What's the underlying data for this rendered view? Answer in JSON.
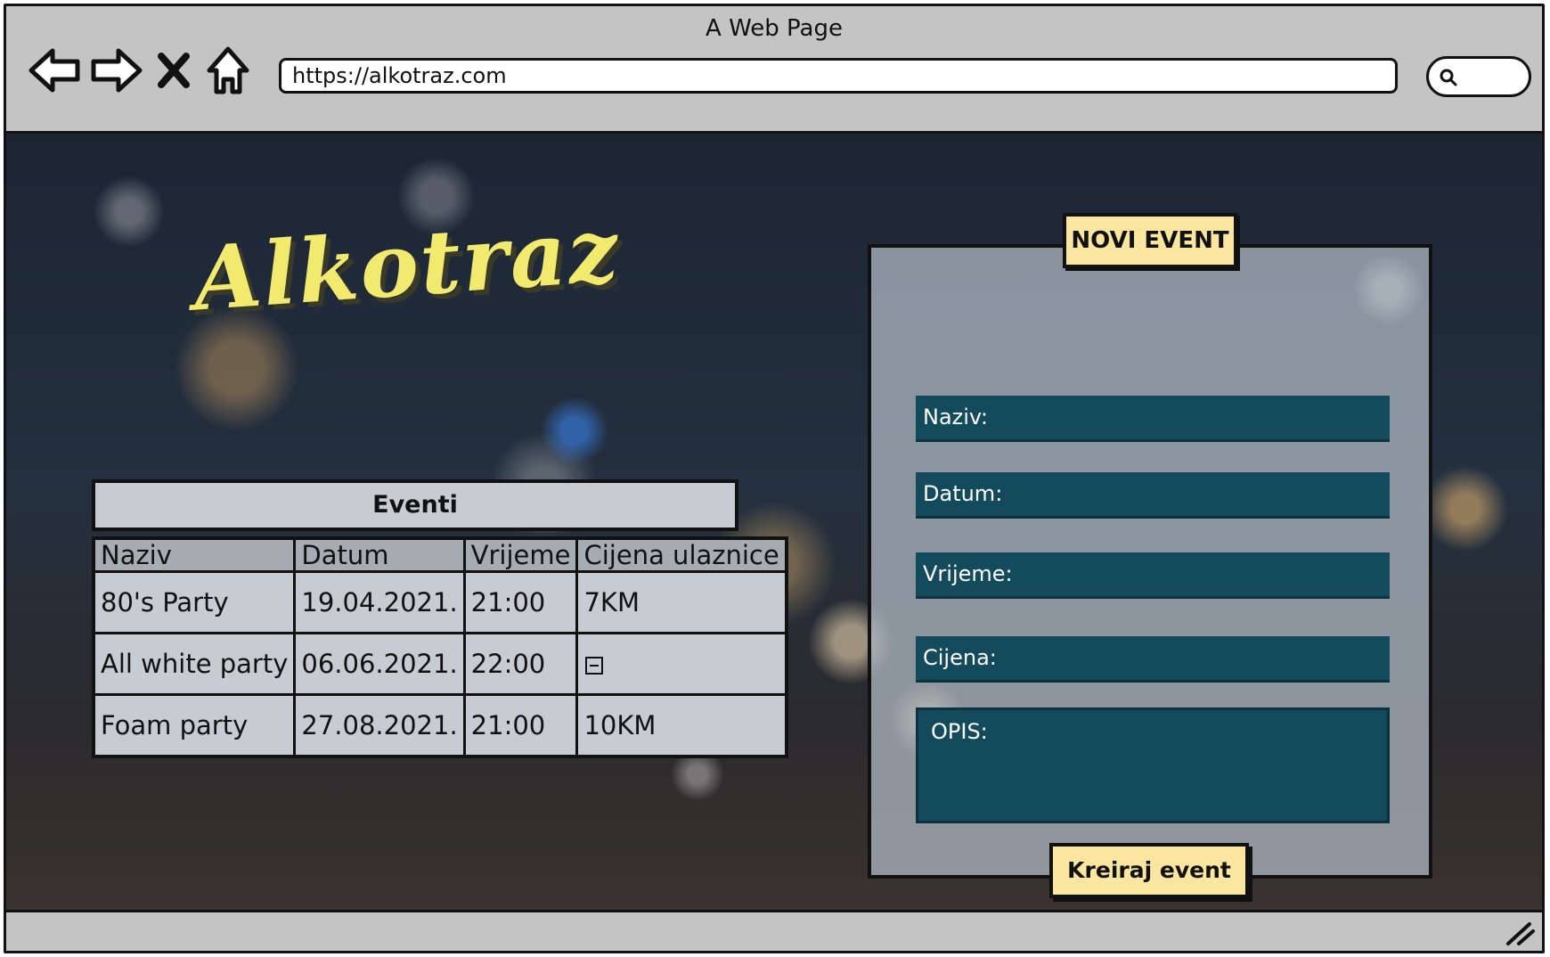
{
  "window": {
    "title": "A Web Page"
  },
  "browser": {
    "url": "https://alkotraz.com",
    "icons": [
      "back-arrow-icon",
      "forward-arrow-icon",
      "close-x-icon",
      "home-icon",
      "search-icon"
    ]
  },
  "page": {
    "logo": "Alkotraz",
    "events": {
      "title": "Eventi",
      "columns": [
        "Naziv",
        "Datum",
        "Vrijeme",
        "Cijena ulaznice"
      ],
      "rows": [
        {
          "naziv": "80's Party",
          "datum": "19.04.2021.",
          "vrijeme": "21:00",
          "cijena": "7KM"
        },
        {
          "naziv": "All white party",
          "datum": "06.06.2021.",
          "vrijeme": "22:00",
          "cijena": "",
          "cijena_icon": "minus-box-icon"
        },
        {
          "naziv": "Foam party",
          "datum": "27.08.2021.",
          "vrijeme": "21:00",
          "cijena": "10KM"
        }
      ]
    },
    "form": {
      "tag": "NOVI EVENT",
      "fields": {
        "naziv": "Naziv:",
        "datum": "Datum:",
        "vrijeme": "Vrijeme:",
        "cijena": "Cijena:",
        "opis": "OPIS:"
      },
      "submit_label": "Kreiraj event"
    }
  },
  "colors": {
    "chrome": "#c4c4c4",
    "logo": "#f1ea6e",
    "field_bg": "#144b5c",
    "button_bg": "#fbe6a0"
  }
}
